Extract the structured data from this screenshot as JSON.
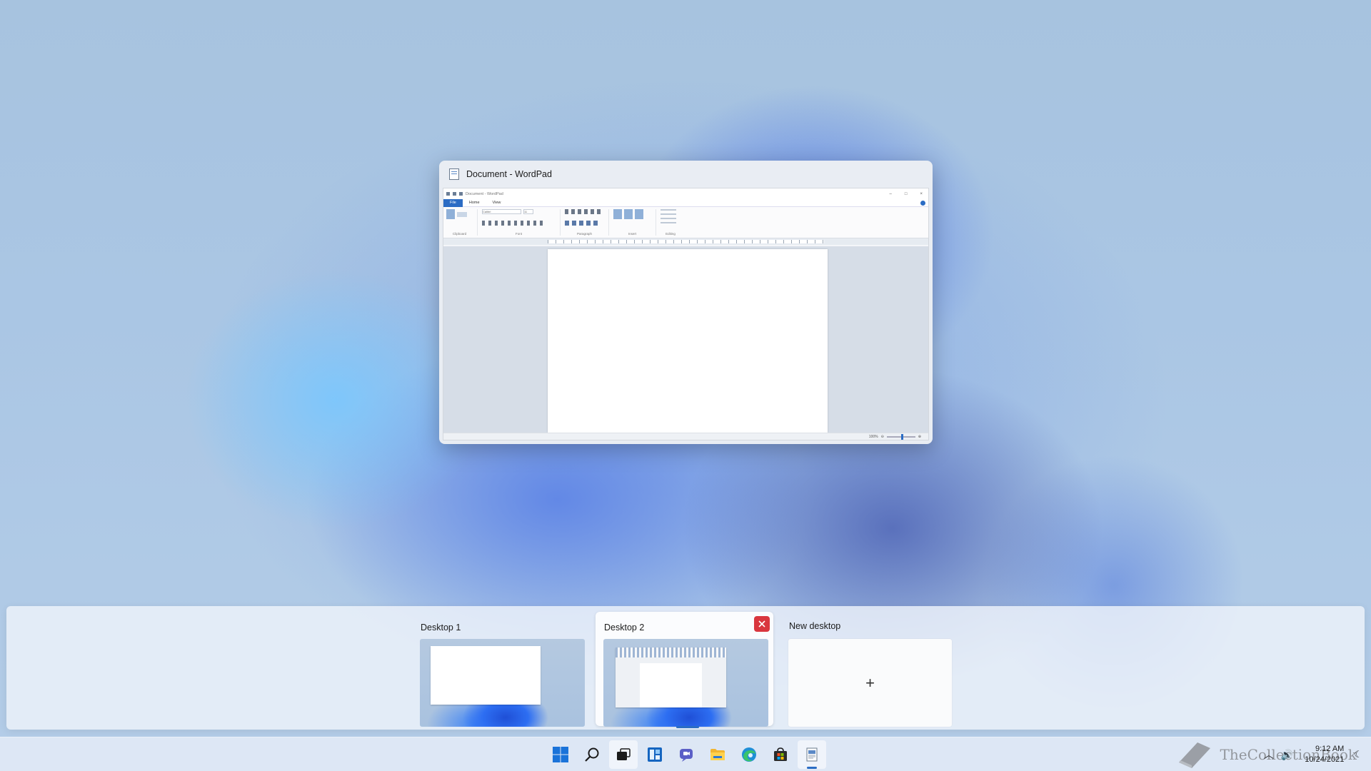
{
  "window_preview": {
    "title": "Document - WordPad",
    "app": {
      "title_text": "Document - WordPad",
      "tabs": [
        "File",
        "Home",
        "View"
      ],
      "ribbon_groups": [
        "Clipboard",
        "Font",
        "Paragraph",
        "Insert",
        "Editing"
      ],
      "font_name": "Calibri",
      "font_size": "11",
      "zoom": "100%"
    }
  },
  "desktops": [
    {
      "label": "Desktop 1",
      "active": false
    },
    {
      "label": "Desktop 2",
      "active": true
    }
  ],
  "new_desktop": {
    "label": "New desktop",
    "plus": "+"
  },
  "taskbar": {
    "icons": [
      "windows-start-icon",
      "search-icon",
      "task-view-icon",
      "widgets-icon",
      "chat-icon",
      "file-explorer-icon",
      "edge-icon",
      "store-icon",
      "wordpad-icon"
    ],
    "active_icon": "wordpad-icon",
    "accent": "#2b6cc4"
  },
  "tray": {
    "time": "9:12 AM",
    "date": "10/24/2021"
  },
  "watermark": "TheCollectionBook"
}
